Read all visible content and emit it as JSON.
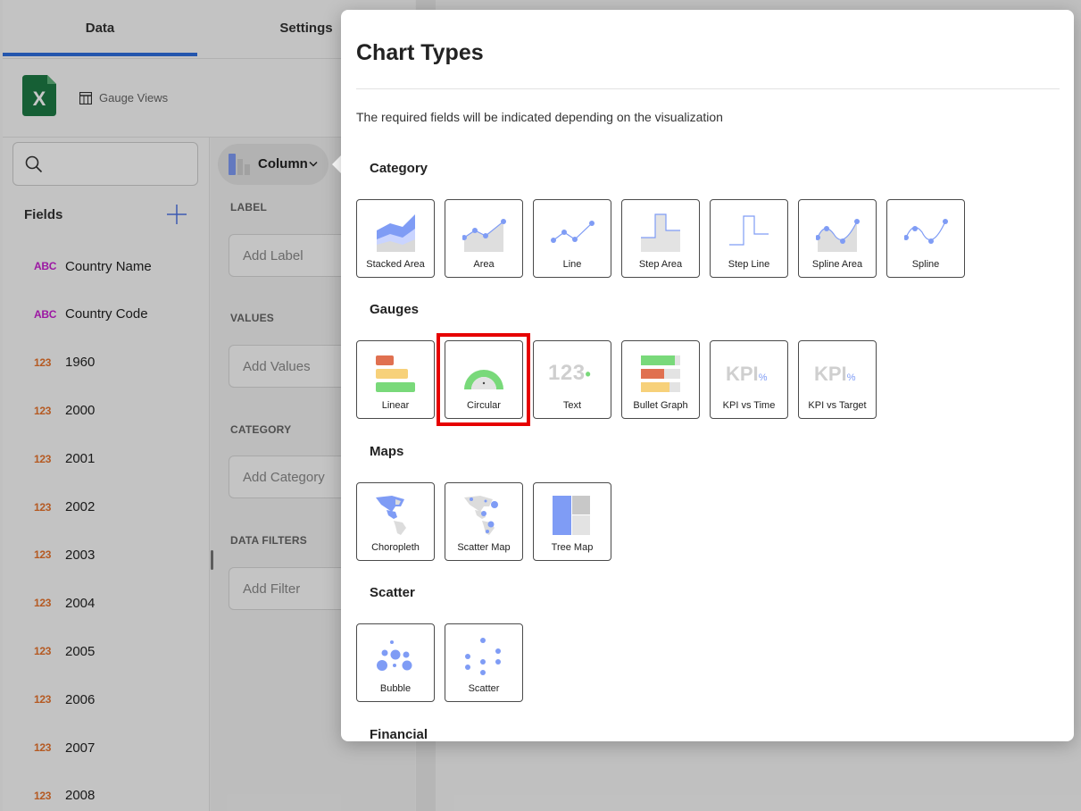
{
  "tabs": {
    "data": "Data",
    "settings": "Settings"
  },
  "source": {
    "name": "Gauge Views"
  },
  "fields": {
    "title": "Fields",
    "items": [
      {
        "type": "ABC",
        "name": "Country Name"
      },
      {
        "type": "ABC",
        "name": "Country Code"
      },
      {
        "type": "123",
        "name": "1960"
      },
      {
        "type": "123",
        "name": "2000"
      },
      {
        "type": "123",
        "name": "2001"
      },
      {
        "type": "123",
        "name": "2002"
      },
      {
        "type": "123",
        "name": "2003"
      },
      {
        "type": "123",
        "name": "2004"
      },
      {
        "type": "123",
        "name": "2005"
      },
      {
        "type": "123",
        "name": "2006"
      },
      {
        "type": "123",
        "name": "2007"
      },
      {
        "type": "123",
        "name": "2008"
      }
    ]
  },
  "editor": {
    "chart_type_label": "Column",
    "label_section": "LABEL",
    "label_placeholder": "Add Label",
    "values_section": "VALUES",
    "values_placeholder": "Add Values",
    "category_section": "CATEGORY",
    "category_placeholder": "Add Category",
    "filters_section": "DATA FILTERS",
    "filters_placeholder": "Add Filter"
  },
  "modal": {
    "title": "Chart Types",
    "subtitle": "The required fields will be indicated depending on the visualization",
    "sections": [
      {
        "title": "Category",
        "items": [
          "Stacked Area",
          "Area",
          "Line",
          "Step Area",
          "Step Line",
          "Spline Area",
          "Spline"
        ]
      },
      {
        "title": "Gauges",
        "items": [
          "Linear",
          "Circular",
          "Text",
          "Bullet Graph",
          "KPI vs Time",
          "KPI vs Target"
        ]
      },
      {
        "title": "Maps",
        "items": [
          "Choropleth",
          "Scatter Map",
          "Tree Map"
        ]
      },
      {
        "title": "Scatter",
        "items": [
          "Bubble",
          "Scatter"
        ]
      },
      {
        "title": "Financial",
        "items": []
      }
    ],
    "selected": "Circular",
    "icon_text": {
      "text_gauge": "123",
      "kpi": "KPI",
      "kpi_pct": "%"
    }
  },
  "colors": {
    "accent": "#2f6fde",
    "chart_blue": "#7f9cf5",
    "gauge_green": "#79d97a",
    "gauge_orange": "#e07050",
    "gauge_yellow": "#f7d17a",
    "highlight": "#e60000"
  }
}
